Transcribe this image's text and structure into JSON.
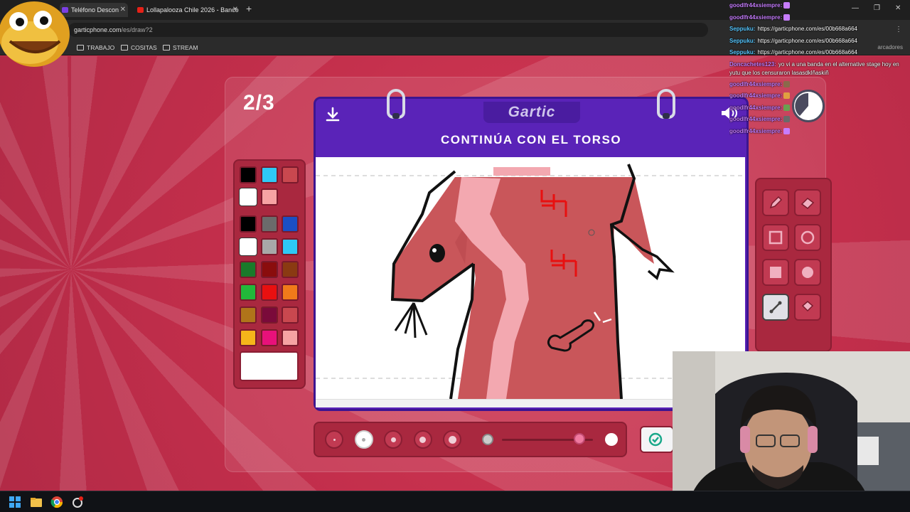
{
  "browser": {
    "tabs": [
      {
        "label": "Teléfono Descon"
      },
      {
        "label": "Lollapalooza Chile 2026 - Banco"
      }
    ],
    "url": {
      "host": "garticphone.com",
      "path": "/es/draw?2"
    },
    "bookmarks": [
      {
        "label": "TRABAJO"
      },
      {
        "label": "COSITAS"
      },
      {
        "label": "STREAM"
      }
    ],
    "bookmarks_right": "arcadores"
  },
  "game": {
    "round": "2/3",
    "logo": "Gartic",
    "instruction": "CONTINÚA CON EL TORSO",
    "colors": {
      "accent": "#5a23b8",
      "panel": "#a9283f",
      "background": "#c9334f"
    },
    "palette_top": [
      "#000000",
      "#2ec9f5",
      "#c9484f",
      "#ffffff",
      "#f6a3a3"
    ],
    "palette": [
      "#000000",
      "#6b6b6b",
      "#1a4fc4",
      "#ffffff",
      "#a8a8a8",
      "#2ec9f5",
      "#1a7a2a",
      "#8a0d0d",
      "#8a3a12",
      "#22b83a",
      "#e81010",
      "#f07a1a",
      "#b0741a",
      "#7a0a3a",
      "#c9484f",
      "#f5b51a",
      "#e8117a",
      "#f6a3a3"
    ],
    "selected_color": "#ffffff",
    "tools": [
      {
        "name": "pencil-icon",
        "selected": false
      },
      {
        "name": "eraser-icon",
        "selected": false
      },
      {
        "name": "rectangle-outline-icon",
        "selected": false
      },
      {
        "name": "ellipse-outline-icon",
        "selected": false
      },
      {
        "name": "rectangle-filled-icon",
        "selected": false
      },
      {
        "name": "ellipse-filled-icon",
        "selected": false
      },
      {
        "name": "line-icon",
        "selected": true
      },
      {
        "name": "bucket-icon",
        "selected": false
      },
      {
        "name": "undo-icon",
        "selected": false
      },
      {
        "name": "redo-icon",
        "selected": false
      }
    ],
    "brush_sizes_selected": 2,
    "opacity": 0.85
  },
  "chat": {
    "messages": [
      {
        "user": "goodlfr44xsiempre:",
        "text": "",
        "emote": "#c77dff"
      },
      {
        "user": "goodlfr44xsiempre:",
        "text": "",
        "emote": "#c77dff"
      },
      {
        "user": "Seppuku:",
        "text": "https://garticphone.com/es/00b668a664",
        "emote": ""
      },
      {
        "user": "Seppuku:",
        "text": "https://garticphone.com/es/00b668a664",
        "emote": ""
      },
      {
        "user": "Seppuku:",
        "text": "https://garticphone.com/es/00b668a664",
        "emote": ""
      },
      {
        "user": "Doncachetes123:",
        "text": "yo vi a una banda en el alternative stage hoy en yutu que los censuraron lasasdklñaskiñ",
        "emote": ""
      },
      {
        "user": "goodlfr44xsiempre:",
        "text": "",
        "emote": "#8a6a4a"
      },
      {
        "user": "goodlfr44xsiempre:",
        "text": "",
        "emote": "#e0a040"
      },
      {
        "user": "goodlfr44xsiempre:",
        "text": "",
        "emote": "#6aa050"
      },
      {
        "user": "goodlfr44xsiempre:",
        "text": "",
        "emote": "#6a6a6a"
      },
      {
        "user": "goodlfr44xsiempre:",
        "text": "",
        "emote": "#c77dff"
      }
    ]
  }
}
